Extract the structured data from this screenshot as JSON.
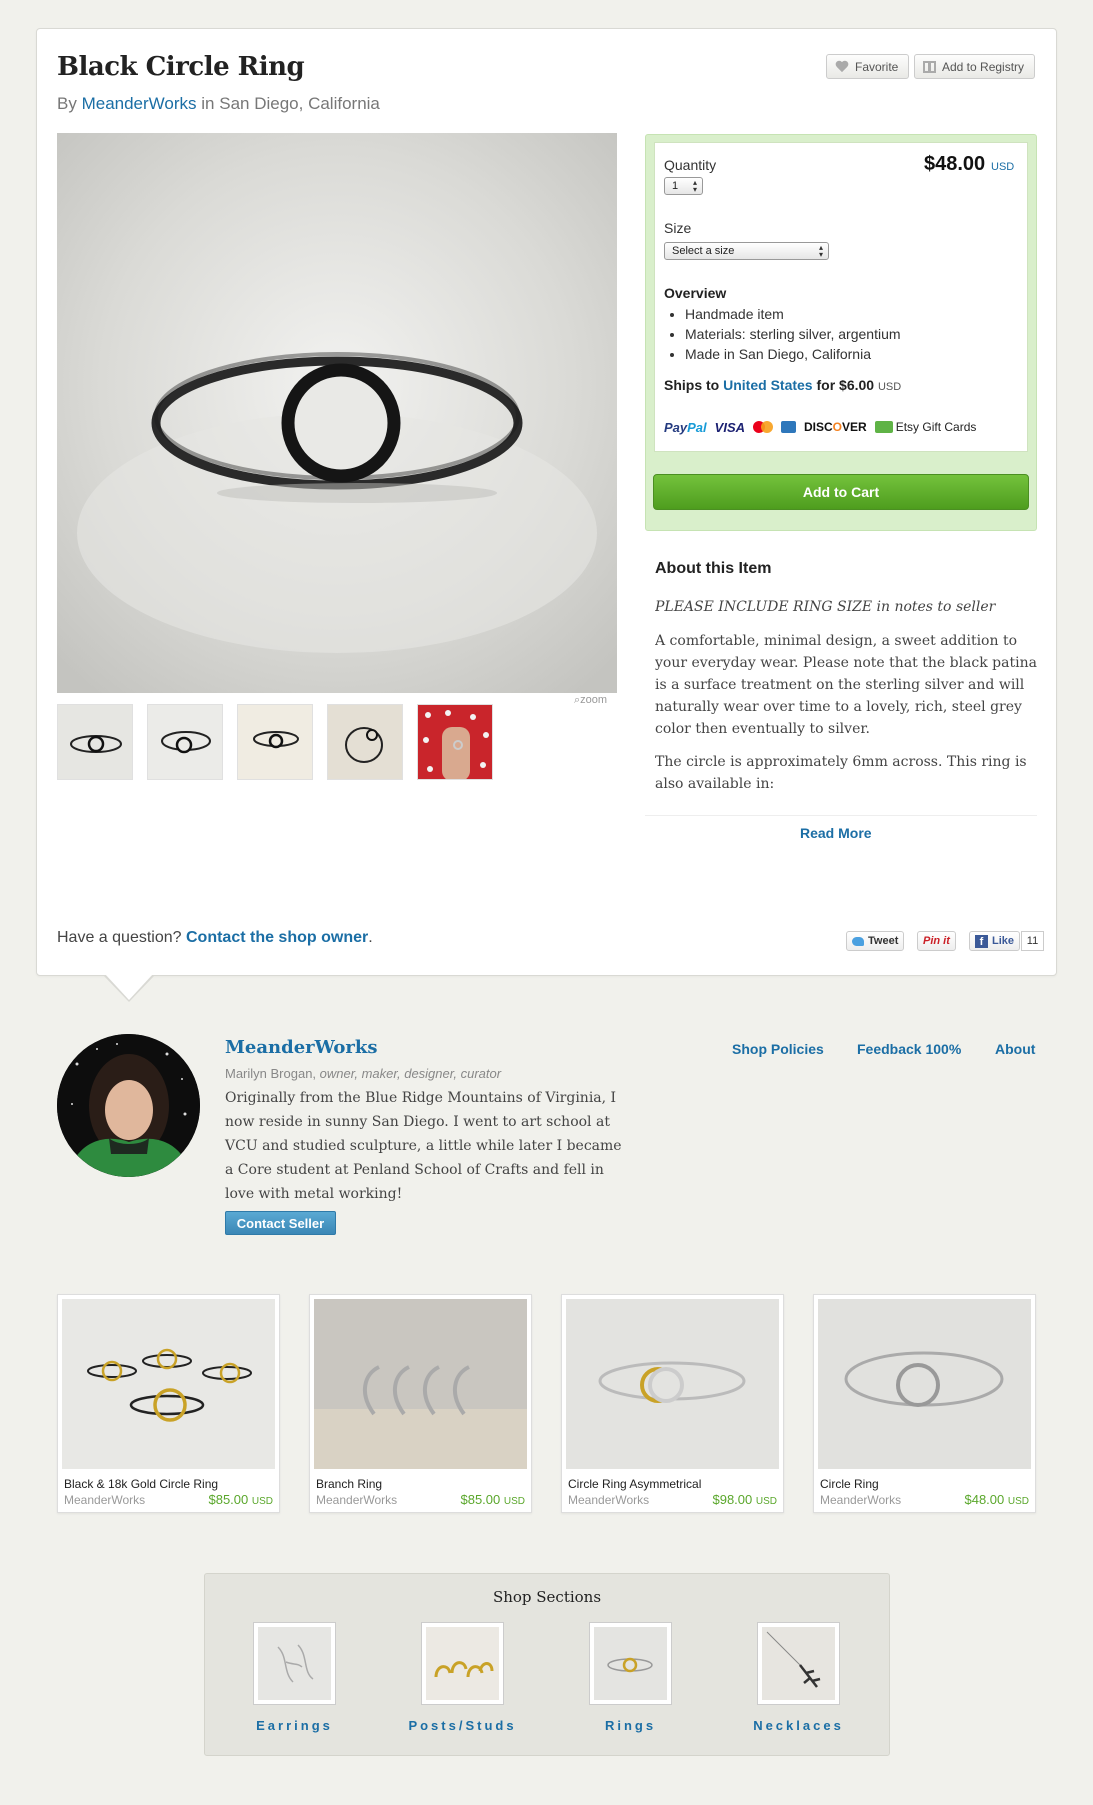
{
  "item": {
    "title": "Black Circle Ring",
    "by": "By",
    "shop": "MeanderWorks",
    "in": "in",
    "location": "San Diego, California",
    "favorite_label": "Favorite",
    "registry_label": "Add to Registry",
    "zoom_label": "zoom"
  },
  "buy": {
    "quantity_label": "Quantity",
    "quantity_value": "1",
    "price": "$48.00",
    "currency": "USD",
    "size_label": "Size",
    "size_placeholder": "Select a size",
    "overview_title": "Overview",
    "overview": [
      "Handmade item",
      "Materials: sterling silver, argentium",
      "Made in San Diego, California"
    ],
    "ships_to": "Ships to",
    "ships_dest": "United States",
    "ships_for": "for $6.00",
    "ships_currency": "USD",
    "payments": {
      "paypal_a": "Pay",
      "paypal_b": "Pal",
      "visa": "VISA",
      "discover_a": "DISC",
      "discover_o": "O",
      "discover_b": "VER",
      "gift": "Etsy Gift Cards"
    },
    "add_to_cart": "Add to Cart"
  },
  "about": {
    "title": "About this Item",
    "note": "PLEASE INCLUDE RING SIZE in notes to seller",
    "p1": "A comfortable, minimal design, a sweet addition to your everyday wear. Please note that the black patina is a surface treatment on the sterling silver and will naturally wear over time to a lovely, rich, steel grey color then eventually to silver.",
    "p2": "The circle is approximately 6mm across. This ring is also available in:",
    "read_more": "Read More"
  },
  "question": {
    "text": "Have a question?",
    "link": "Contact the shop owner",
    "period": "."
  },
  "social": {
    "tweet": "Tweet",
    "pin": "Pin it",
    "like": "Like",
    "like_count": "11"
  },
  "owner": {
    "shop_name": "MeanderWorks",
    "name": "Marilyn Brogan,",
    "roles": "owner, maker, designer, curator",
    "bio": "Originally from the Blue Ridge Mountains of Virginia, I now reside in sunny San Diego. I went to art school at VCU and studied sculpture, a little while later I became a Core student at Penland School of Crafts and fell in love with metal working!",
    "contact": "Contact Seller",
    "links": [
      "Shop Policies",
      "Feedback 100%",
      "About"
    ]
  },
  "listings": [
    {
      "title": "Black & 18k Gold Circle Ring",
      "shop": "MeanderWorks",
      "price": "$85.00",
      "currency": "USD"
    },
    {
      "title": "Branch Ring",
      "shop": "MeanderWorks",
      "price": "$85.00",
      "currency": "USD"
    },
    {
      "title": "Circle Ring Asymmetrical",
      "shop": "MeanderWorks",
      "price": "$98.00",
      "currency": "USD"
    },
    {
      "title": "Circle Ring",
      "shop": "MeanderWorks",
      "price": "$48.00",
      "currency": "USD"
    }
  ],
  "sections": {
    "title": "Shop Sections",
    "items": [
      "Earrings",
      "Posts/Studs",
      "Rings",
      "Necklaces"
    ]
  },
  "colors": {
    "link": "#1b6ea5",
    "cart_green": "#5fae2b",
    "price_green": "#5aa72b",
    "buy_box_bg": "#d9efcb",
    "contact_blue": "#4a98c6"
  }
}
